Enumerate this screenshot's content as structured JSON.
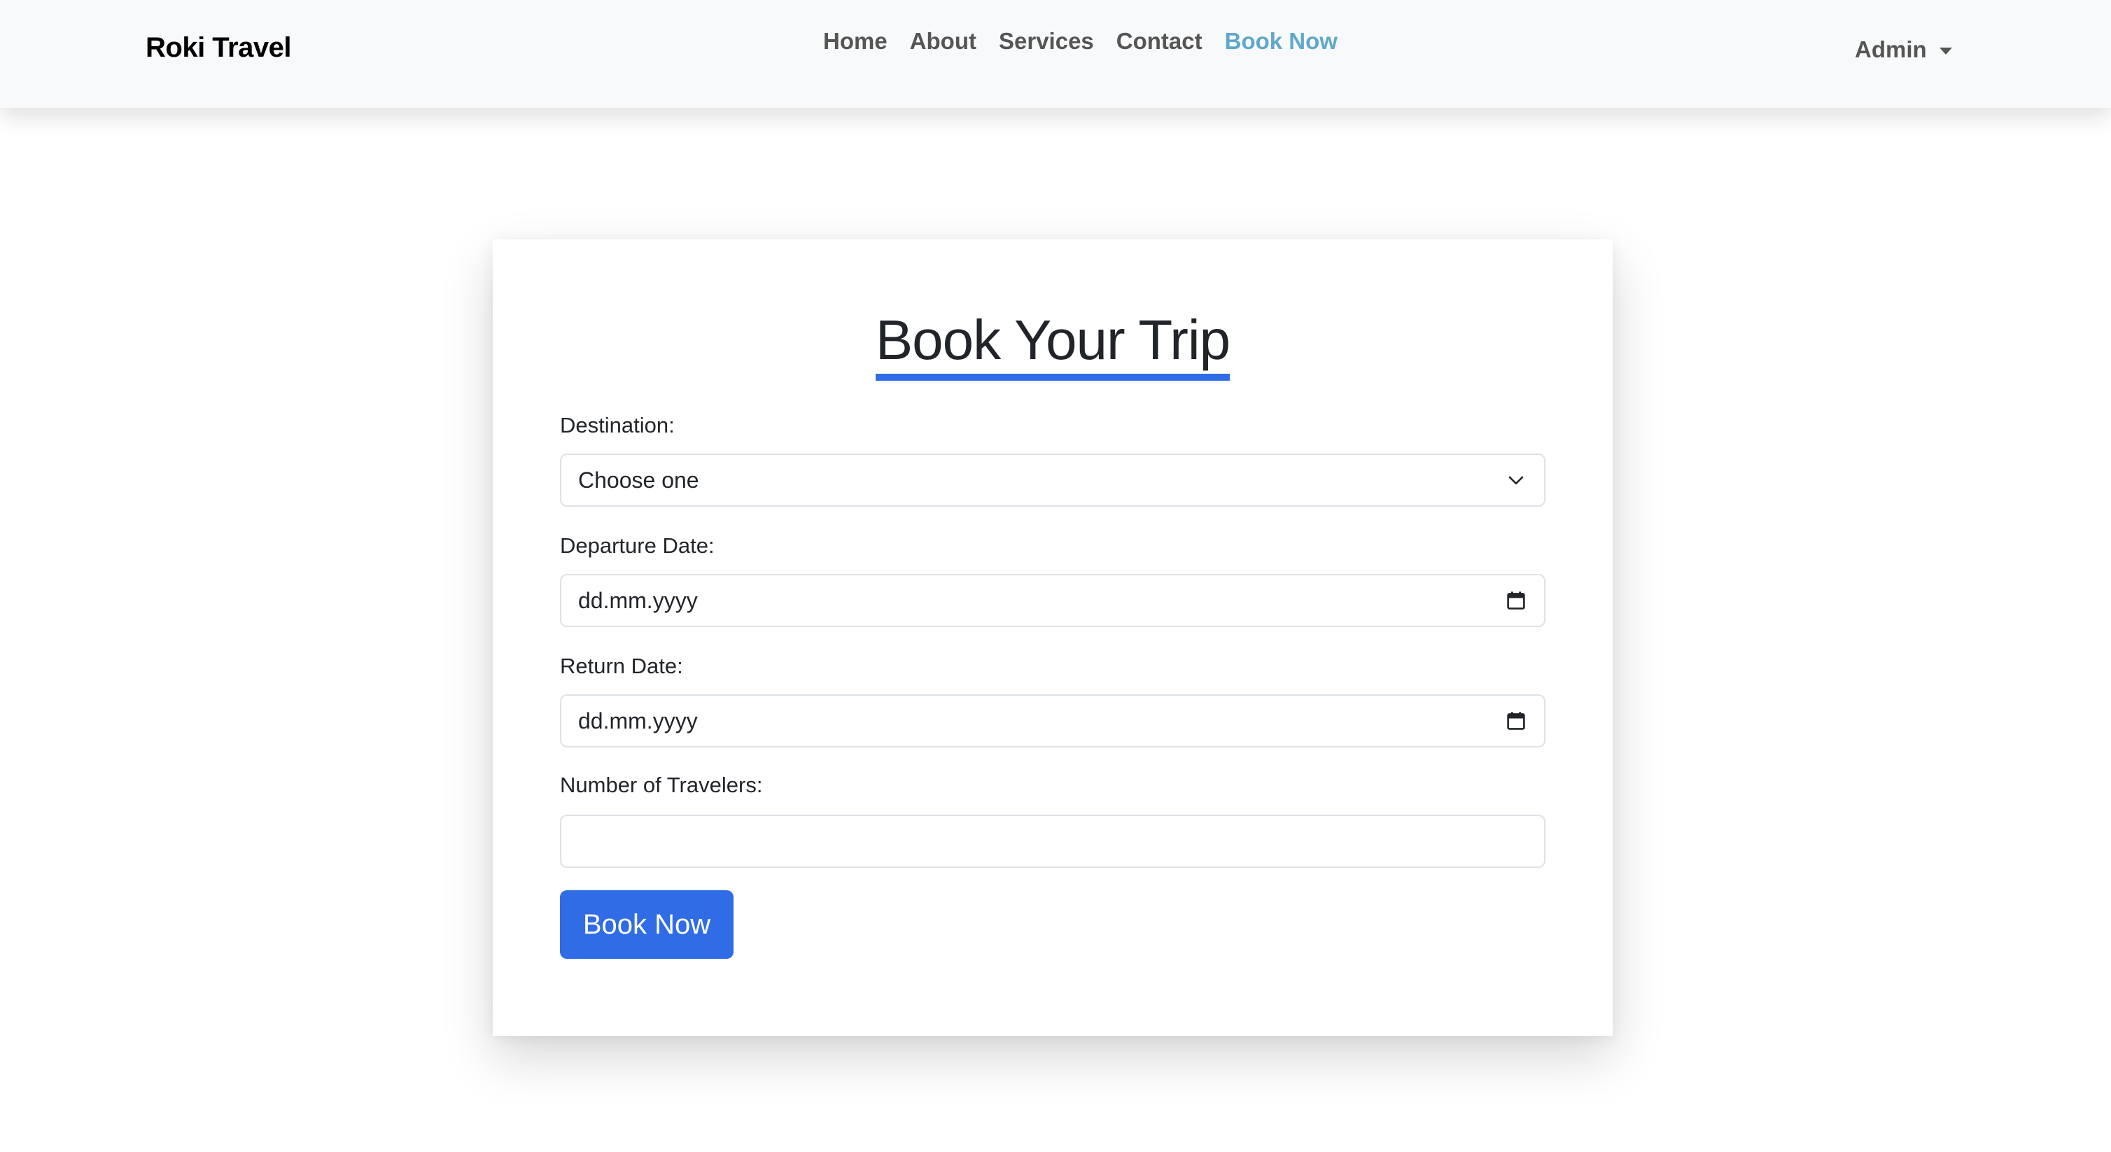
{
  "navbar": {
    "brand": "Roki Travel",
    "links": [
      {
        "label": "Home",
        "active": false
      },
      {
        "label": "About",
        "active": false
      },
      {
        "label": "Services",
        "active": false
      },
      {
        "label": "Contact",
        "active": false
      },
      {
        "label": "Book Now",
        "active": true
      }
    ],
    "user_menu": {
      "label": "Admin",
      "icon": "caret-down-icon"
    }
  },
  "booking_form": {
    "title": "Book Your Trip",
    "fields": {
      "destination": {
        "label": "Destination:",
        "value": "Choose one",
        "icon": "chevron-down-icon"
      },
      "departure_date": {
        "label": "Departure Date:",
        "value": "dd.mm.yyyy",
        "icon": "calendar-icon"
      },
      "return_date": {
        "label": "Return Date:",
        "value": "dd.mm.yyyy",
        "icon": "calendar-icon"
      },
      "travelers": {
        "label": "Number of Travelers:",
        "value": ""
      }
    },
    "submit_label": "Book Now"
  },
  "colors": {
    "accent": "#2f6ce5",
    "active_link": "#5fa8c9",
    "nav_text": "#555555",
    "navbar_bg": "#f8f9fa"
  }
}
